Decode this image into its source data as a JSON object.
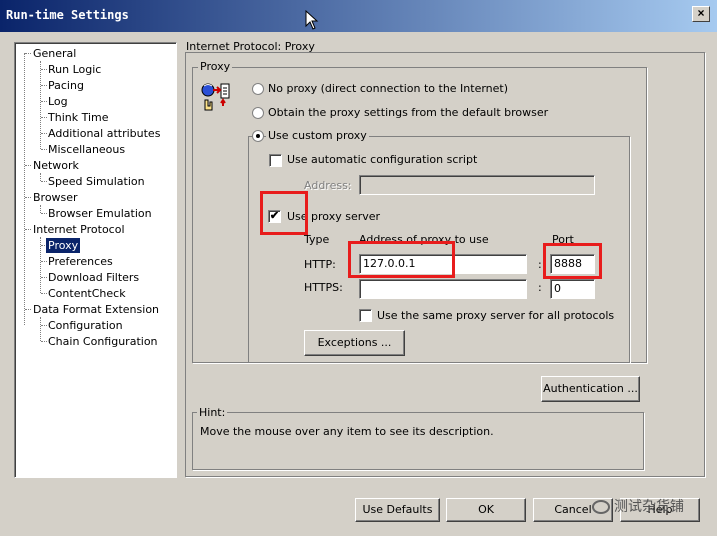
{
  "window": {
    "title": "Run-time Settings",
    "close_glyph": "×"
  },
  "tree": {
    "items": [
      {
        "label": "General"
      },
      {
        "label": "Run Logic"
      },
      {
        "label": "Pacing"
      },
      {
        "label": "Log"
      },
      {
        "label": "Think Time"
      },
      {
        "label": "Additional attributes"
      },
      {
        "label": "Miscellaneous"
      },
      {
        "label": "Network"
      },
      {
        "label": "Speed Simulation"
      },
      {
        "label": "Browser"
      },
      {
        "label": "Browser Emulation"
      },
      {
        "label": "Internet Protocol"
      },
      {
        "label": "Proxy"
      },
      {
        "label": "Preferences"
      },
      {
        "label": "Download Filters"
      },
      {
        "label": "ContentCheck"
      },
      {
        "label": "Data Format Extension"
      },
      {
        "label": "Configuration"
      },
      {
        "label": "Chain Configuration"
      }
    ],
    "selected": "Proxy"
  },
  "panel": {
    "title": "Internet Protocol: Proxy",
    "proxy_group": "Proxy",
    "no_proxy": "No proxy (direct connection to the Internet)",
    "browser_proxy": "Obtain the proxy settings from the default browser",
    "custom_proxy": "Use custom proxy",
    "auto_config": "Use automatic configuration script",
    "address_label": "Address:",
    "address_value": "",
    "use_proxy_server": "Use proxy server",
    "use_proxy_checked": "✔",
    "col_type": "Type",
    "col_address": "Address of proxy to use",
    "col_port": "Port",
    "http_label": "HTTP:",
    "http_address": "127.0.0.1",
    "http_port": "8888",
    "https_label": "HTTPS:",
    "https_address": "",
    "https_port": "0",
    "colon": ":",
    "same_proxy": "Use the same proxy server for all protocols",
    "exceptions_button": "Exceptions ...",
    "authentication_button": "Authentication ...",
    "hint_group": "Hint:",
    "hint_text": "Move the mouse over any item to see its description."
  },
  "footer": {
    "use_defaults": "Use Defaults",
    "ok": "OK",
    "cancel": "Cancel",
    "help": "Help"
  },
  "watermark": {
    "text": "测试杂货铺"
  },
  "colors": {
    "highlight_box": "#e81c1c",
    "selection": "#0a246a"
  },
  "icons": {
    "proxy": "proxy-network-icon",
    "cursor": "mouse-pointer-icon"
  }
}
